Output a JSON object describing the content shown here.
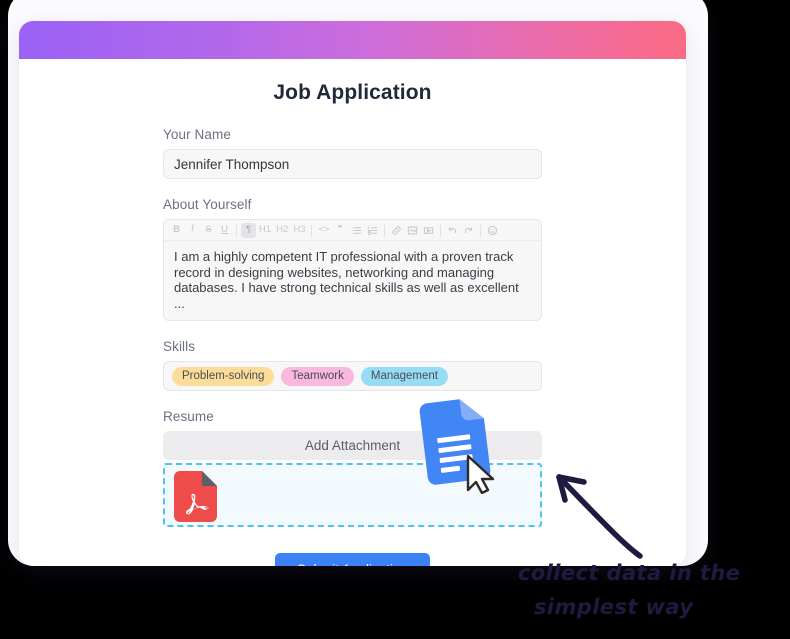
{
  "form": {
    "title": "Job Application",
    "banner_gradient_from": "#9a62f5",
    "banner_gradient_to": "#fa6a82",
    "fields": {
      "name": {
        "label": "Your Name",
        "value": "Jennifer Thompson",
        "placeholder": "Your Name"
      },
      "about": {
        "label": "About Yourself",
        "value": "I am a highly competent IT professional with a proven track record in designing websites, networking and managing databases. I have strong technical skills as well as excellent ...",
        "placeholder": "About Yourself",
        "toolbar": [
          {
            "name": "bold-button",
            "glyph": "B",
            "style": "bold",
            "active": false
          },
          {
            "name": "italic-button",
            "glyph": "I",
            "style": "italic",
            "active": false
          },
          {
            "name": "strikethrough-button",
            "glyph": "S",
            "style": "strike",
            "active": false
          },
          {
            "name": "underline-button",
            "glyph": "U",
            "style": "under",
            "active": false
          },
          {
            "name": "separator-1",
            "glyph": "",
            "style": "sep",
            "active": false
          },
          {
            "name": "paragraph-button",
            "glyph": "¶",
            "style": "plain",
            "active": true
          },
          {
            "name": "heading-1-button",
            "glyph": "H1",
            "style": "plain",
            "active": false
          },
          {
            "name": "heading-2-button",
            "glyph": "H2",
            "style": "plain",
            "active": false
          },
          {
            "name": "heading-3-button",
            "glyph": "H3",
            "style": "plain",
            "active": false
          },
          {
            "name": "separator-2",
            "glyph": "",
            "style": "sep",
            "active": false
          },
          {
            "name": "code-block-button",
            "glyph": "<>",
            "style": "plain",
            "active": false
          },
          {
            "name": "blockquote-button",
            "glyph": "❞",
            "style": "plain",
            "active": false
          },
          {
            "name": "bullet-list-button",
            "glyph": "icon-ul",
            "style": "svg",
            "active": false
          },
          {
            "name": "numbered-list-button",
            "glyph": "icon-ol",
            "style": "svg",
            "active": false
          },
          {
            "name": "separator-3",
            "glyph": "",
            "style": "sep",
            "active": false
          },
          {
            "name": "link-button",
            "glyph": "icon-link",
            "style": "svg",
            "active": false
          },
          {
            "name": "image-button",
            "glyph": "icon-image",
            "style": "svg",
            "active": false
          },
          {
            "name": "video-button",
            "glyph": "icon-video",
            "style": "svg",
            "active": false
          },
          {
            "name": "separator-4",
            "glyph": "",
            "style": "sep",
            "active": false
          },
          {
            "name": "undo-button",
            "glyph": "icon-undo",
            "style": "svg",
            "active": false
          },
          {
            "name": "redo-button",
            "glyph": "icon-redo",
            "style": "svg",
            "active": false
          },
          {
            "name": "separator-5",
            "glyph": "",
            "style": "sep",
            "active": false
          },
          {
            "name": "emoji-button",
            "glyph": "icon-emoji",
            "style": "svg",
            "active": false
          }
        ]
      },
      "skills": {
        "label": "Skills",
        "tags": [
          {
            "label": "Problem-solving",
            "color": "#fbdd99"
          },
          {
            "label": "Teamwork",
            "color": "#f9b8dd"
          },
          {
            "label": "Management",
            "color": "#97dcf5"
          }
        ]
      },
      "resume": {
        "label": "Resume",
        "attach_label": "Add Attachment",
        "dropzone_border_color": "#4ec2f0",
        "dropzone_fill_color": "#f2fafe",
        "attached_file_icon": "pdf-file-icon",
        "dragged_file_icon": "document-file-icon"
      }
    },
    "submit_label": "Submit Application",
    "submit_color": "#3b82f6"
  },
  "annotation": {
    "arrow": "curved-arrow-pointing-left",
    "text_line_1": "collect data in the",
    "text_line_2": "simplest way",
    "color": "#1d1b3f"
  }
}
